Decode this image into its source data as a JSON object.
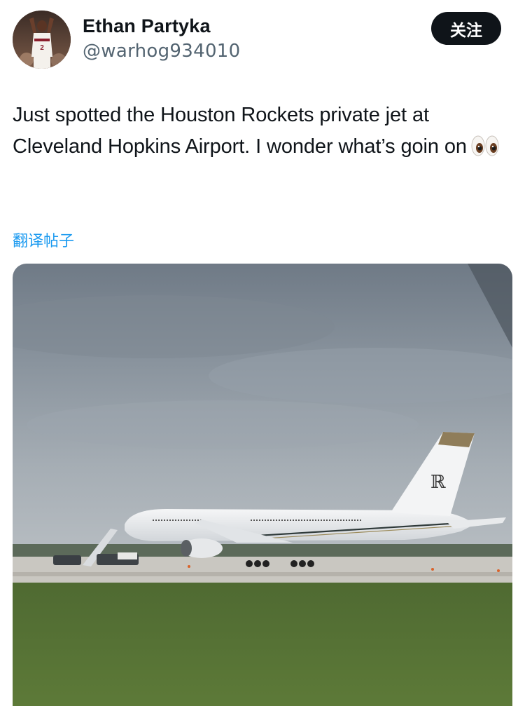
{
  "author": {
    "name": "Ethan Partyka",
    "handle": "@warhog934010"
  },
  "follow_button": {
    "label": "关注"
  },
  "tweet": {
    "text": "Just spotted the Houston Rockets private jet at Cleveland Hopkins Airport. I wonder what’s goin on"
  },
  "translate_link": {
    "label": "翻译帖子"
  },
  "icons": {
    "eyes": "eyes-emoji",
    "avatar": "player-avatar"
  },
  "colors": {
    "link": "#1d9bf0",
    "text": "#0f1419",
    "muted": "#536471",
    "button_bg": "#0f1419"
  }
}
